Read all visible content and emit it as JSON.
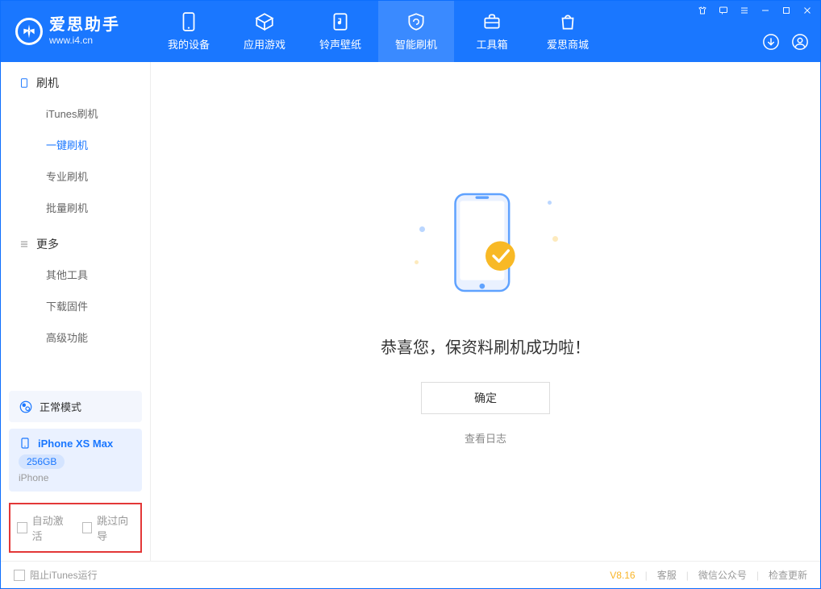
{
  "app": {
    "name": "爱思助手",
    "url": "www.i4.cn"
  },
  "nav": {
    "my_device": "我的设备",
    "apps_games": "应用游戏",
    "ringtones_wallpapers": "铃声壁纸",
    "smart_flash": "智能刷机",
    "toolbox": "工具箱",
    "store": "爱思商城"
  },
  "sidebar": {
    "flash": {
      "title": "刷机",
      "items": {
        "itunes": "iTunes刷机",
        "one_key": "一键刷机",
        "pro": "专业刷机",
        "batch": "批量刷机"
      }
    },
    "more": {
      "title": "更多",
      "items": {
        "other_tools": "其他工具",
        "download_firmware": "下载固件",
        "advanced": "高级功能"
      }
    },
    "mode_status": "正常模式",
    "device": {
      "name": "iPhone XS Max",
      "capacity": "256GB",
      "type": "iPhone"
    },
    "options": {
      "auto_activate": "自动激活",
      "skip_wizard": "跳过向导"
    }
  },
  "main": {
    "message": "恭喜您，保资料刷机成功啦！",
    "ok_button": "确定",
    "log_link": "查看日志"
  },
  "footer": {
    "block_itunes": "阻止iTunes运行",
    "version": "V8.16",
    "support": "客服",
    "wechat": "微信公众号",
    "check_update": "检查更新"
  }
}
